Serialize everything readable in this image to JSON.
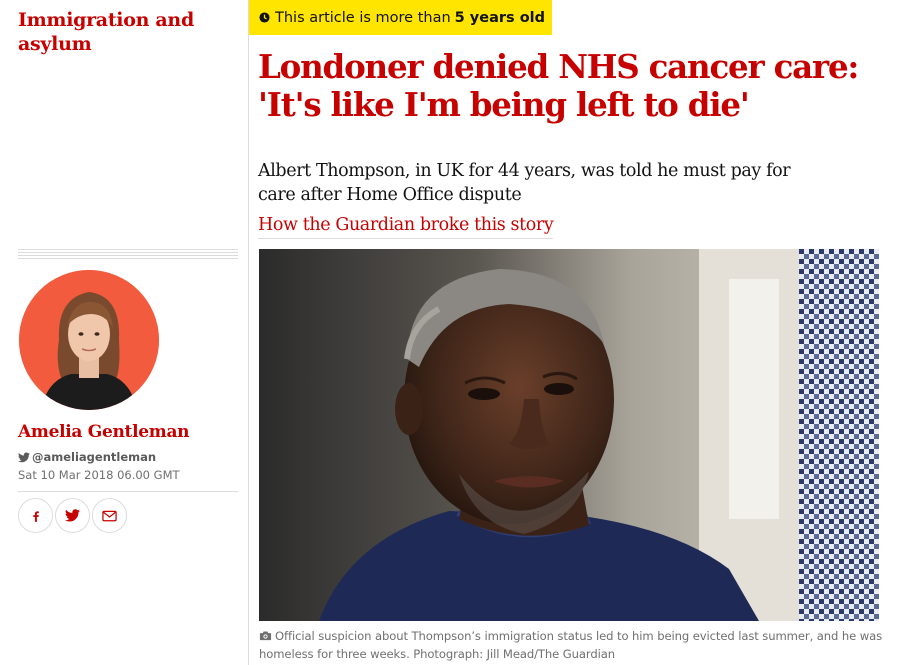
{
  "section": {
    "tag": "Immigration and asylum"
  },
  "badge": {
    "prefix": "This article is more than",
    "emphasis": "5 years old"
  },
  "article": {
    "headline": "Londoner denied NHS cancer care: 'It's like I'm being left to die'",
    "standfirst": "Albert Thompson, in UK for 44 years, was told he must pay for care after Home Office dispute",
    "related_link": "How the Guardian broke this story",
    "caption": "Official suspicion about Thompson’s immigration status led to him being evicted last summer, and he was homeless for three weeks. Photograph: Jill Mead/The Guardian"
  },
  "byline": {
    "author": "Amelia Gentleman",
    "twitter": "@ameliagentleman",
    "date": "Sat 10 Mar 2018 06.00 GMT"
  },
  "share": {
    "icons": [
      "facebook-icon",
      "twitter-icon",
      "email-icon"
    ]
  },
  "colors": {
    "brand_red": "#c70000",
    "badge_yellow": "#ffe500",
    "avatar_bg": "#f25b3d"
  }
}
